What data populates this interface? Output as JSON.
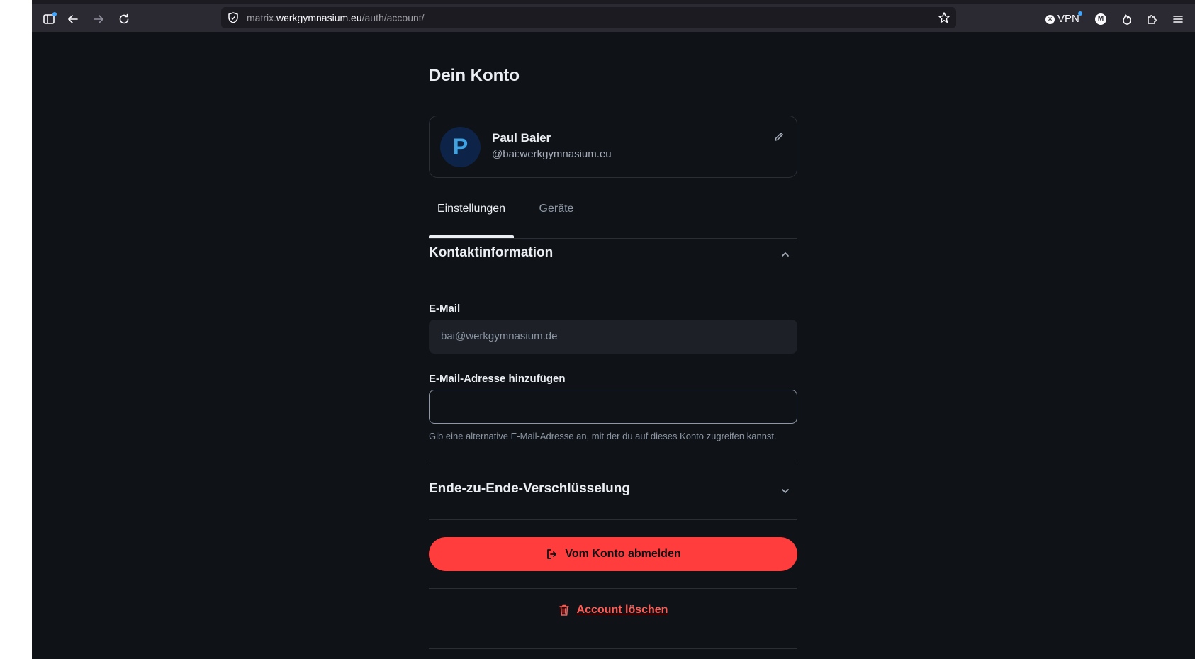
{
  "browser": {
    "url_prefix": "matrix.",
    "url_host": "werkgymnasium.eu",
    "url_path": "/auth/account/",
    "vpn_label": "VPN",
    "account_badge": "M"
  },
  "page": {
    "title": "Dein Konto"
  },
  "profile": {
    "avatar_letter": "P",
    "name": "Paul Baier",
    "user_id": "@bai:werkgymnasium.eu"
  },
  "tabs": [
    {
      "label": "Einstellungen",
      "active": true
    },
    {
      "label": "Geräte",
      "active": false
    }
  ],
  "contact": {
    "section_title": "Kontaktinformation",
    "email_label": "E-Mail",
    "email_value": "bai@werkgymnasium.de",
    "add_email_label": "E-Mail-Adresse hinzufügen",
    "add_email_value": "",
    "add_email_hint": "Gib eine alternative E-Mail-Adresse an, mit der du auf dieses Konto zugreifen kannst."
  },
  "encryption": {
    "section_title": "Ende-zu-Ende-Verschlüsselung"
  },
  "actions": {
    "logout_label": "Vom Konto abmelden",
    "delete_label": "Account löschen"
  },
  "colors": {
    "background": "#0f1216",
    "accent_danger": "#ff3d3d",
    "toolbar": "#2b2a33"
  }
}
